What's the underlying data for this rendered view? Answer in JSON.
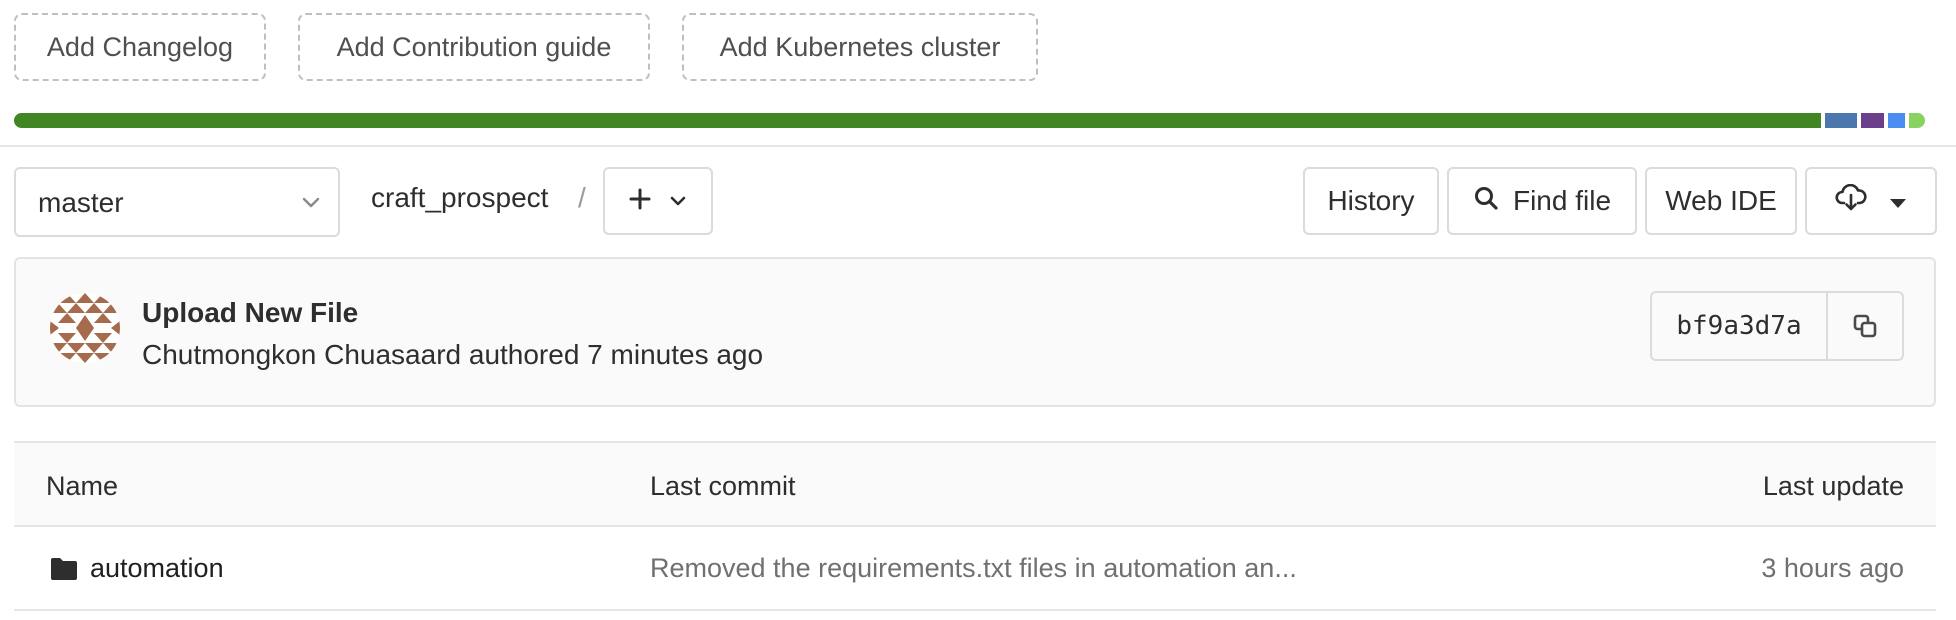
{
  "suggestions": [
    "Add Changelog",
    "Add Contribution guide",
    "Add Kubernetes cluster"
  ],
  "language_bar": [
    {
      "color": "#428524",
      "share": 0.948
    },
    {
      "color": "#4c77ad",
      "share": 0.017
    },
    {
      "color": "#6b3f8c",
      "share": 0.012
    },
    {
      "color": "#4b8cf0",
      "share": 0.009
    },
    {
      "color": "#88d260",
      "share": 0.008
    }
  ],
  "toolbar": {
    "branch": "master",
    "project": "craft_prospect",
    "separator": "/",
    "add_icon": "plus-icon",
    "history": "History",
    "find_file": "Find file",
    "web_ide": "Web IDE",
    "download_icon": "cloud-download-icon"
  },
  "commit": {
    "title": "Upload New File",
    "author": "Chutmongkon Chuasaard",
    "meta": "Chutmongkon Chuasaard authored 7 minutes ago",
    "sha": "bf9a3d7a",
    "copy_icon": "copy-icon",
    "avatar_color": "#a66a4d"
  },
  "table": {
    "columns": [
      "Name",
      "Last commit",
      "Last update"
    ],
    "rows": [
      {
        "icon": "folder-icon",
        "name": "automation",
        "last_commit": "Removed the requirements.txt files in automation an...",
        "last_update": "3 hours ago"
      }
    ]
  }
}
